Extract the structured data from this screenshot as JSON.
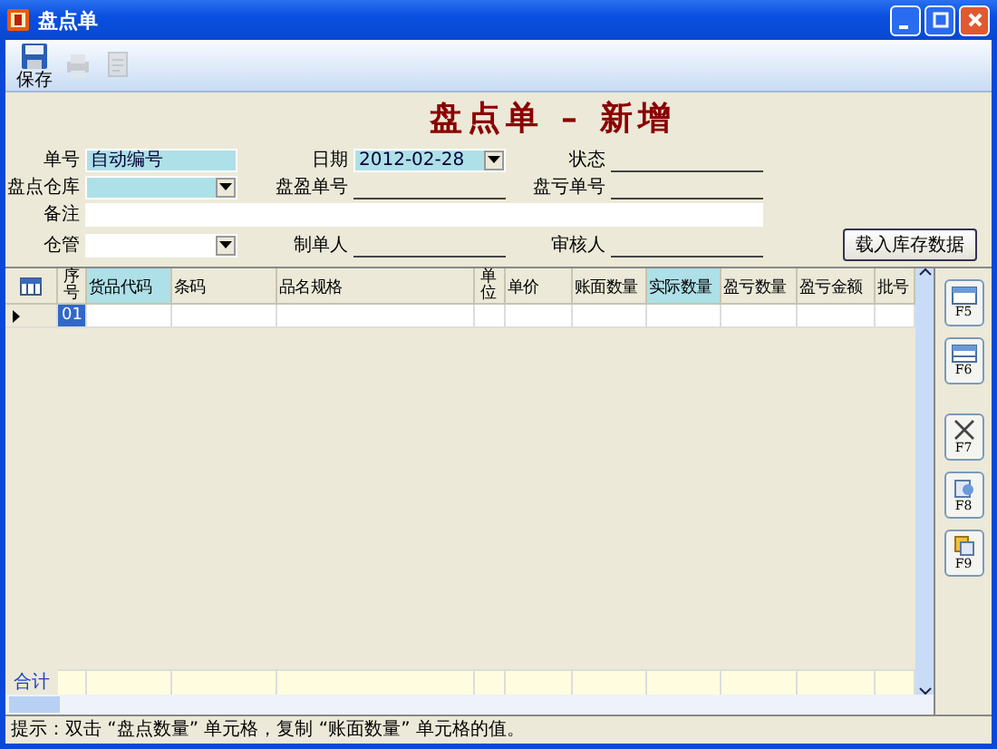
{
  "window": {
    "title": "盘点单"
  },
  "toolbar": [
    {
      "kind": "save",
      "label": "保存",
      "disabled": false
    },
    {
      "kind": "print",
      "disabled": true
    },
    {
      "kind": "export",
      "disabled": true
    }
  ],
  "heading": "盘点单 – 新增",
  "form": [
    [
      {
        "label": "单号",
        "kind": "text",
        "value": "自动编号",
        "highlighted": true
      },
      {
        "label": "日期",
        "kind": "combo",
        "value": "2012-02-28",
        "highlighted": true
      },
      {
        "label": "状态",
        "kind": "line"
      }
    ],
    [
      {
        "label": "盘点仓库",
        "kind": "combo",
        "highlighted": true
      },
      {
        "label": "盘盈单号",
        "kind": "line"
      },
      {
        "label": "盘亏单号",
        "kind": "line"
      }
    ],
    [
      {
        "label": "备注",
        "kind": "wide",
        "highlighted": false
      }
    ],
    [
      {
        "label": "仓管",
        "kind": "combo",
        "highlighted": false
      },
      {
        "label": "制单人",
        "kind": "line"
      },
      {
        "label": "审核人",
        "kind": "line"
      }
    ]
  ],
  "load_button": "载入库存数据",
  "grid": {
    "columns": [
      {
        "label": "序号",
        "highlighted": false
      },
      {
        "label": "货品代码",
        "highlighted": true
      },
      {
        "label": "条码",
        "highlighted": false
      },
      {
        "label": "品名规格",
        "highlighted": false
      },
      {
        "label": "单位",
        "highlighted": false
      },
      {
        "label": "单价",
        "highlighted": false
      },
      {
        "label": "账面数量",
        "highlighted": false
      },
      {
        "label": "实际数量",
        "highlighted": true
      },
      {
        "label": "盈亏数量",
        "highlighted": false
      },
      {
        "label": "盈亏金额",
        "highlighted": false
      },
      {
        "label": "批号",
        "highlighted": false
      }
    ],
    "rows": [
      {
        "cells": [
          "01",
          "",
          "",
          "",
          "",
          "",
          "",
          "",
          "",
          "",
          ""
        ],
        "current": true
      }
    ],
    "total_label": "合计"
  },
  "side_buttons": [
    {
      "kind": "add",
      "key": "F5"
    },
    {
      "kind": "insert",
      "key": "F6"
    },
    {
      "kind": "delete",
      "key": "F7"
    },
    {
      "kind": "find",
      "key": "F8"
    },
    {
      "kind": "copy",
      "key": "F9"
    }
  ],
  "status_bar": "提示：双击 “盘点数量” 单元格，复制 “账面数量” 单元格的值。"
}
